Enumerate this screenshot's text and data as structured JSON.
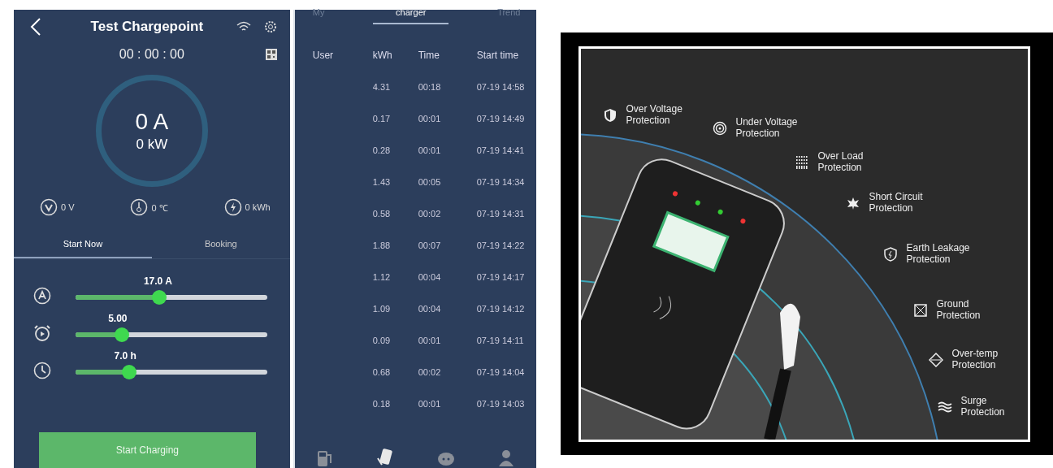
{
  "charge_screen": {
    "title": "Test Chargepoint",
    "timer": "00 : 00 : 00",
    "current": "0 A",
    "power": "0 kW",
    "stats": [
      {
        "kind": "voltage",
        "value": "0 V"
      },
      {
        "kind": "temperature",
        "value": "0 ℃"
      },
      {
        "kind": "energy",
        "value": "0 kWh"
      }
    ],
    "tabs": [
      {
        "label": "Start Now",
        "selected": true
      },
      {
        "label": "Booking",
        "selected": false
      }
    ],
    "sliders": [
      {
        "kind": "current",
        "reading": "17.0 A",
        "level": 0.43
      },
      {
        "kind": "alarm",
        "reading": "5.00",
        "level": 0.22
      },
      {
        "kind": "duration",
        "reading": "7.0 h",
        "level": 0.26
      }
    ],
    "button": "Start Charging"
  },
  "history_screen": {
    "tabs": [
      {
        "label": "My",
        "selected": false
      },
      {
        "label": "charger",
        "selected": true
      },
      {
        "label": "Trend",
        "selected": false
      }
    ],
    "columns": [
      "User",
      "kWh",
      "Time",
      "Start time"
    ],
    "rows": [
      [
        "",
        "4.31",
        "00:18",
        "07-19 14:58"
      ],
      [
        "",
        "0.17",
        "00:01",
        "07-19 14:49"
      ],
      [
        "",
        "0.28",
        "00:01",
        "07-19 14:41"
      ],
      [
        "",
        "1.43",
        "00:05",
        "07-19 14:34"
      ],
      [
        "",
        "0.58",
        "00:02",
        "07-19 14:31"
      ],
      [
        "",
        "1.88",
        "00:07",
        "07-19 14:22"
      ],
      [
        "",
        "1.12",
        "00:04",
        "07-19 14:17"
      ],
      [
        "",
        "1.09",
        "00:04",
        "07-19 14:12"
      ],
      [
        "",
        "0.09",
        "00:01",
        "07-19 14:11"
      ],
      [
        "",
        "0.68",
        "00:02",
        "07-19 14:04"
      ],
      [
        "",
        "0.18",
        "00:01",
        "07-19 14:03"
      ]
    ],
    "nav": [
      {
        "kind": "station",
        "selected": false
      },
      {
        "kind": "phone",
        "selected": true
      },
      {
        "kind": "chat",
        "selected": false
      },
      {
        "kind": "person",
        "selected": false
      }
    ]
  },
  "protections": [
    {
      "kind": "shield",
      "lines": [
        "Over Voltage",
        "Protection"
      ]
    },
    {
      "kind": "rings",
      "lines": [
        "Under Voltage",
        "Protection"
      ]
    },
    {
      "kind": "dots",
      "lines": [
        "Over Load",
        "Protection"
      ]
    },
    {
      "kind": "burst",
      "lines": [
        "Short Circuit",
        "Protection"
      ]
    },
    {
      "kind": "leak",
      "lines": [
        "Earth Leakage",
        "Protection"
      ]
    },
    {
      "kind": "ground",
      "lines": [
        "Ground",
        "Protection"
      ]
    },
    {
      "kind": "temp",
      "lines": [
        "Over-temp",
        "Protection"
      ]
    },
    {
      "kind": "surge",
      "lines": [
        "Surge",
        "Protection"
      ]
    }
  ]
}
